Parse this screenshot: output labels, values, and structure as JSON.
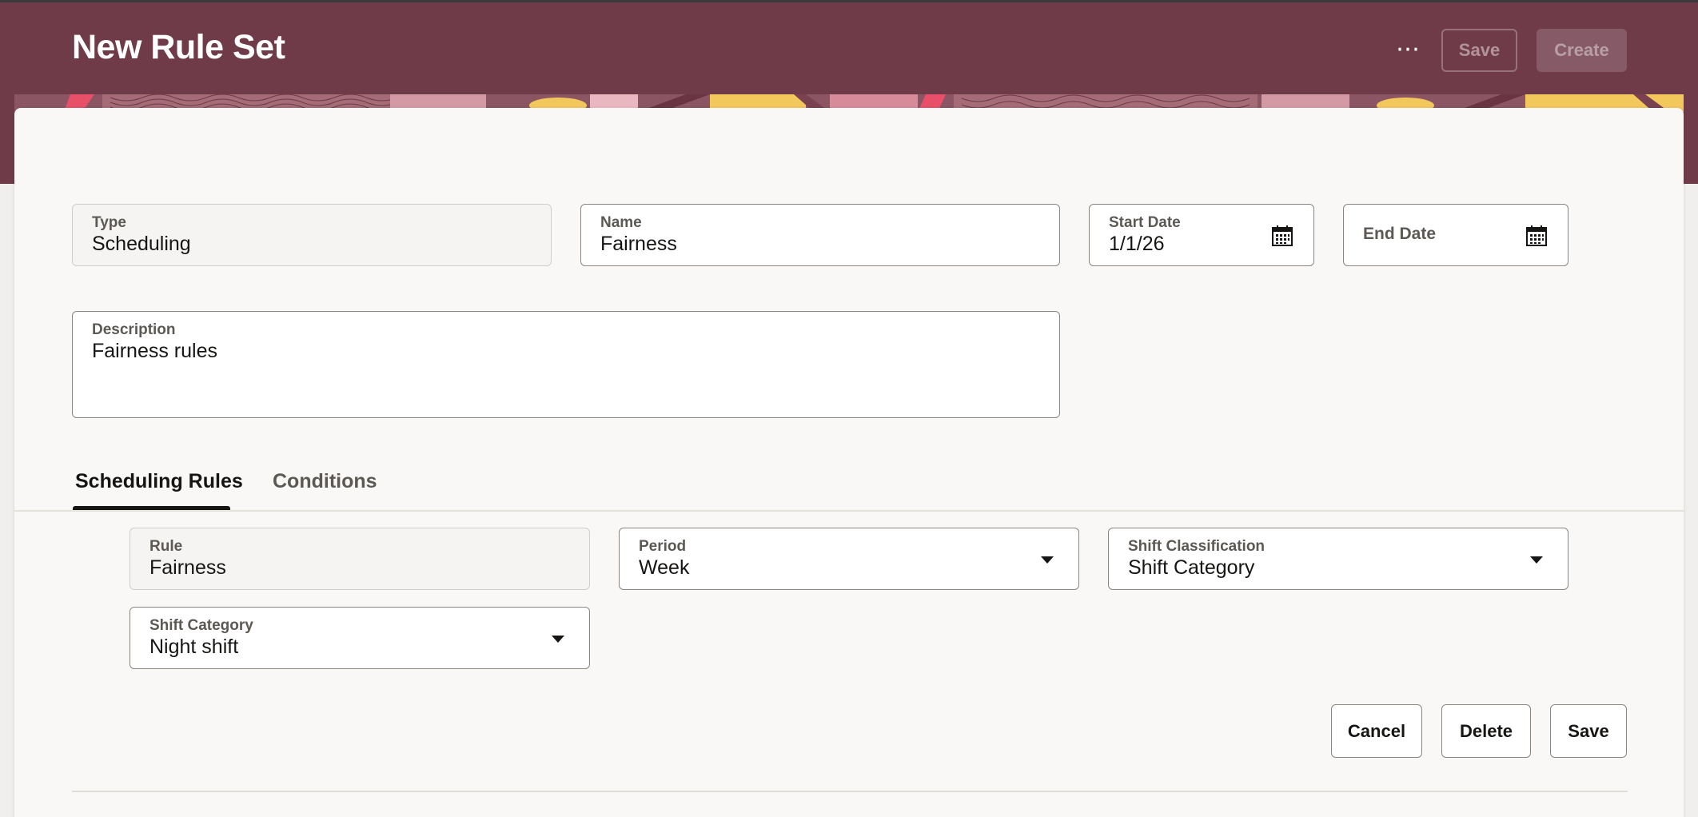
{
  "header": {
    "title": "New Rule Set",
    "more_label": "⋯",
    "save_label": "Save",
    "create_label": "Create",
    "background_color": "#6f3b49"
  },
  "form": {
    "type": {
      "label": "Type",
      "value": "Scheduling"
    },
    "name": {
      "label": "Name",
      "value": "Fairness"
    },
    "start_date": {
      "label": "Start Date",
      "value": "1/1/26",
      "icon": "calendar-icon"
    },
    "end_date": {
      "label": "End Date",
      "value": "",
      "icon": "calendar-icon"
    },
    "description": {
      "label": "Description",
      "value": "Fairness rules"
    }
  },
  "tabs": [
    {
      "label": "Scheduling Rules",
      "active": true
    },
    {
      "label": "Conditions",
      "active": false
    }
  ],
  "rule": {
    "rule": {
      "label": "Rule",
      "value": "Fairness"
    },
    "period": {
      "label": "Period",
      "value": "Week",
      "icon": "chevron-down-icon"
    },
    "shift_classification": {
      "label": "Shift Classification",
      "value": "Shift Category",
      "icon": "chevron-down-icon"
    },
    "shift_category": {
      "label": "Shift Category",
      "value": "Night shift",
      "icon": "chevron-down-icon"
    }
  },
  "actions": {
    "cancel_label": "Cancel",
    "delete_label": "Delete",
    "save_label": "Save"
  }
}
